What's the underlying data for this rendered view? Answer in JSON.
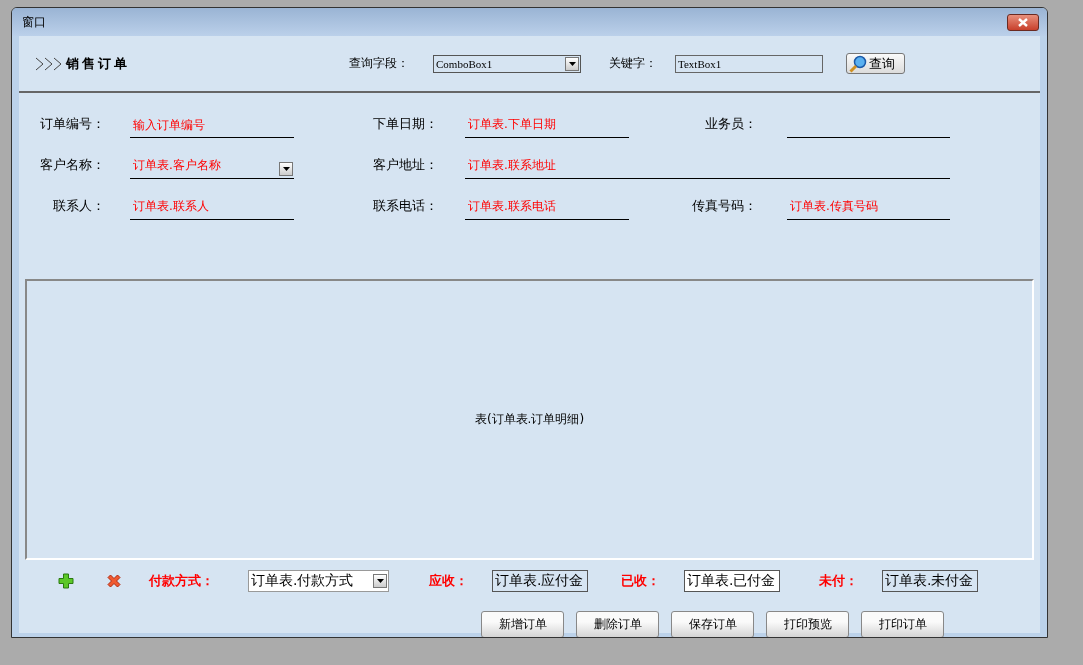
{
  "window": {
    "title": "窗口"
  },
  "header": {
    "title": "销售订单",
    "query_field_label": "查询字段：",
    "query_field_value": "ComboBox1",
    "keyword_label": "关键字：",
    "keyword_value": "TextBox1",
    "search_button": "查询"
  },
  "form": {
    "rows": [
      {
        "fields": [
          {
            "label": "订单编号：",
            "placeholder": "输入订单编号",
            "kind": "text"
          },
          {
            "label": "下单日期：",
            "value": "订单表.下单日期",
            "kind": "text"
          },
          {
            "label": "业务员：",
            "kind": "text"
          }
        ]
      },
      {
        "fields": [
          {
            "label": "客户名称：",
            "value": "订单表.客户名称",
            "kind": "combo"
          },
          {
            "label": "客户地址：",
            "value": "订单表.联系地址",
            "kind": "wide"
          }
        ]
      },
      {
        "fields": [
          {
            "label": "联系人：",
            "value": "订单表.联系人",
            "kind": "text"
          },
          {
            "label": "联系电话：",
            "value": "订单表.联系电话",
            "kind": "text"
          },
          {
            "label": "传真号码：",
            "value": "订单表.传真号码",
            "kind": "text"
          }
        ]
      }
    ]
  },
  "detail_table": {
    "caption": "表(订单表.订单明细)"
  },
  "payment": {
    "method_label": "付款方式：",
    "method_value": "订单表.付款方式",
    "amounts": [
      {
        "label": "应收：",
        "value": "订单表.应付金",
        "selected": false
      },
      {
        "label": "已收：",
        "value": "订单表.已付金",
        "selected": true
      },
      {
        "label": "未付：",
        "value": "订单表.未付金",
        "selected": false
      }
    ]
  },
  "buttons": [
    "新增订单",
    "删除订单",
    "保存订单",
    "打印预览",
    "打印订单"
  ]
}
